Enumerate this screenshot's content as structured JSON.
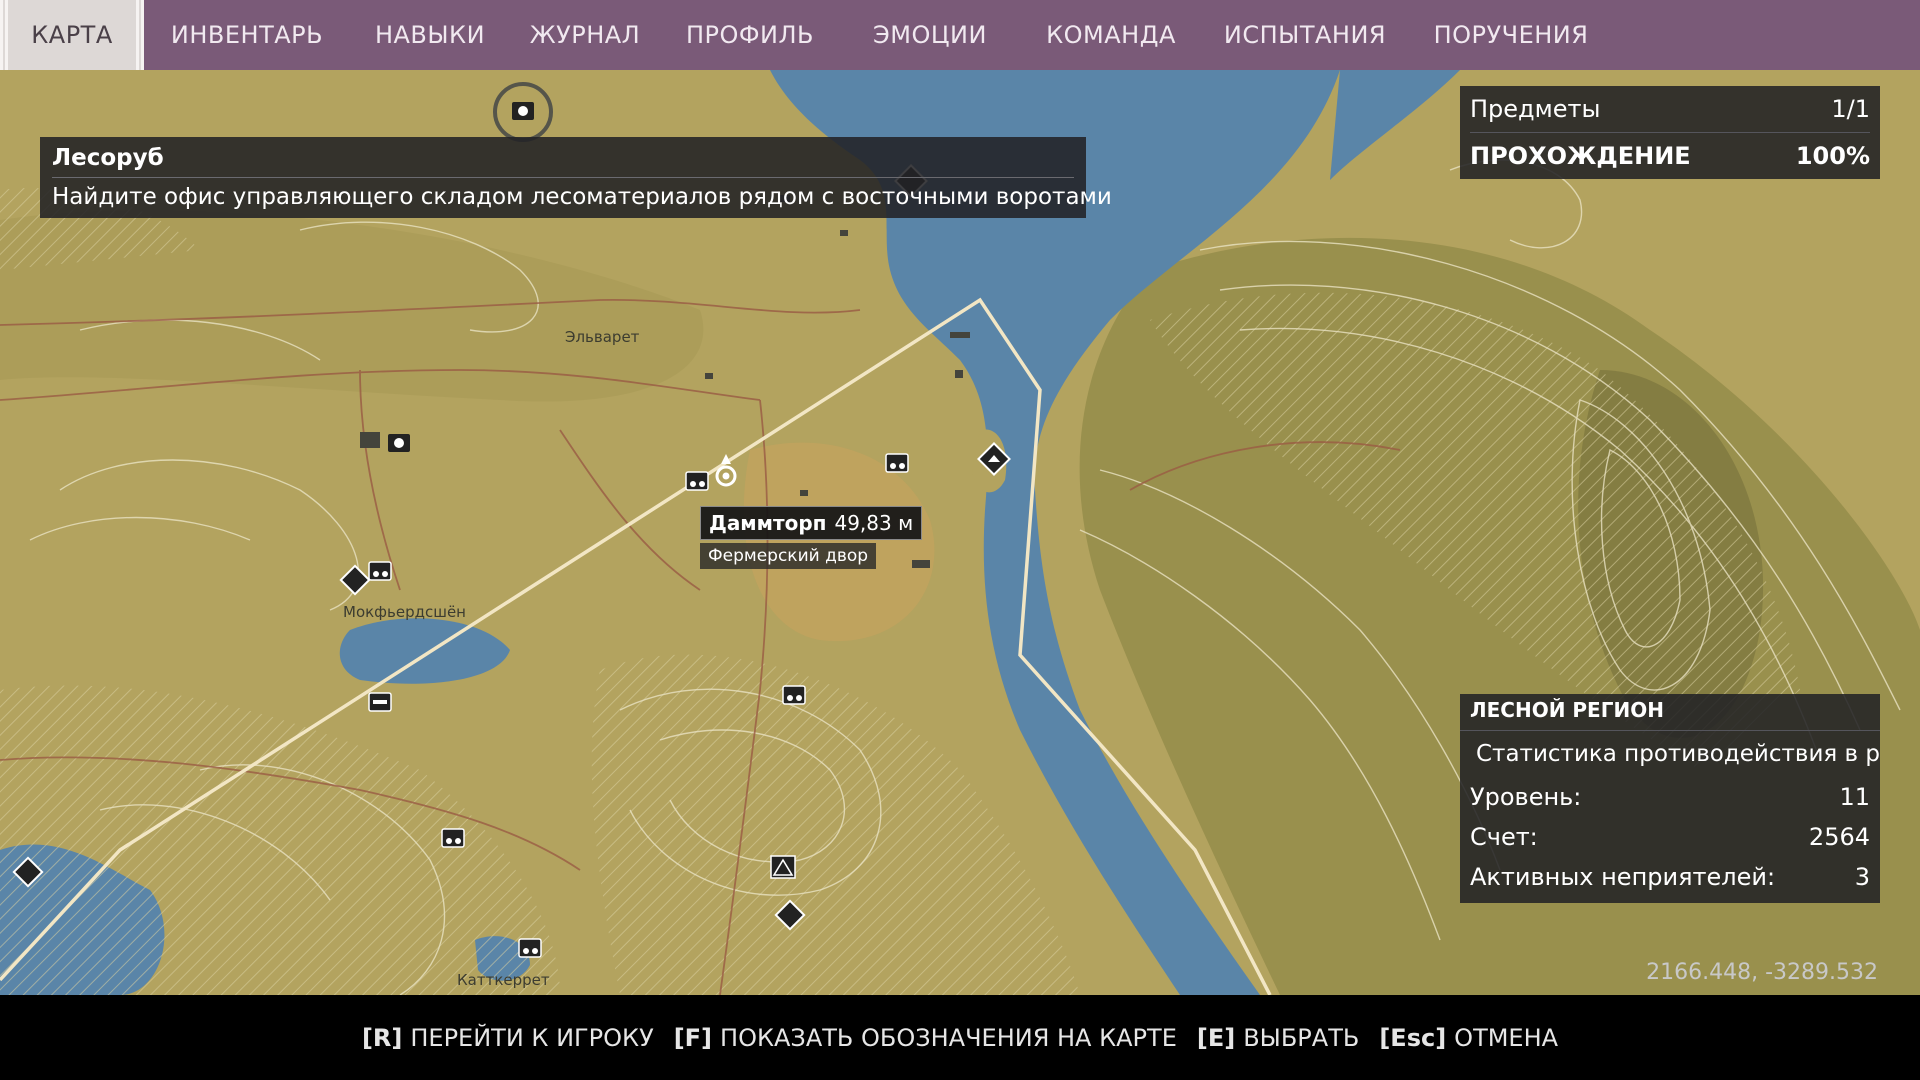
{
  "topnav": {
    "tabs": [
      {
        "label": "КАРТА",
        "active": true
      },
      {
        "label": "ИНВЕНТАРЬ"
      },
      {
        "label": "НАВЫКИ"
      },
      {
        "label": "ЖУРНАЛ"
      },
      {
        "label": "ПРОФИЛЬ"
      },
      {
        "label": "ЭМОЦИИ"
      },
      {
        "label": "КОМАНДА"
      },
      {
        "label": "ИСПЫТАНИЯ"
      },
      {
        "label": "ПОРУЧЕНИЯ"
      }
    ]
  },
  "quest": {
    "title": "Лесоруб",
    "description": "Найдите офис управляющего складом лесоматериалов рядом с восточными воротами"
  },
  "items_panel": {
    "items_label": "Предметы",
    "items_value": "1/1",
    "progress_label": "ПРОХОЖДЕНИЕ",
    "progress_value": "100%"
  },
  "region_panel": {
    "title": "ЛЕСНОЙ РЕГИОН",
    "subtitle": "Статистика противодействия в ре",
    "level_label": "Уровень:",
    "level_value": "11",
    "score_label": "Счет:",
    "score_value": "2564",
    "enemies_label": "Активных неприятелей:",
    "enemies_value": "3"
  },
  "marker": {
    "name": "Даммторп",
    "distance": "49,83 м",
    "subtitle": "Фермерский двор"
  },
  "towns": {
    "elvaret": "Эльварет",
    "mokfierdsion": "Мокфьердсшён",
    "kattkerret": "Катткеррет"
  },
  "coordinates": "2166.448, -3289.532",
  "bottombar": {
    "hints": [
      {
        "key": "[R]",
        "label": "ПЕРЕЙТИ К ИГРОКУ"
      },
      {
        "key": "[F]",
        "label": "ПОКАЗАТЬ ОБОЗНАЧЕНИЯ НА КАРТЕ"
      },
      {
        "key": "[E]",
        "label": "ВЫБРАТЬ"
      },
      {
        "key": "[Esc]",
        "label": "ОТМЕНА"
      }
    ]
  },
  "colors": {
    "nav_bg": "#7a5a78",
    "land": "#b4a460",
    "water": "#5a85a8",
    "route": "#f2e6c4"
  },
  "icons": [
    "camera-icon",
    "farm-tractor-icon",
    "shelter-icon",
    "bunker-icon",
    "tent-icon",
    "player-marker-icon",
    "safehouse-icon"
  ]
}
